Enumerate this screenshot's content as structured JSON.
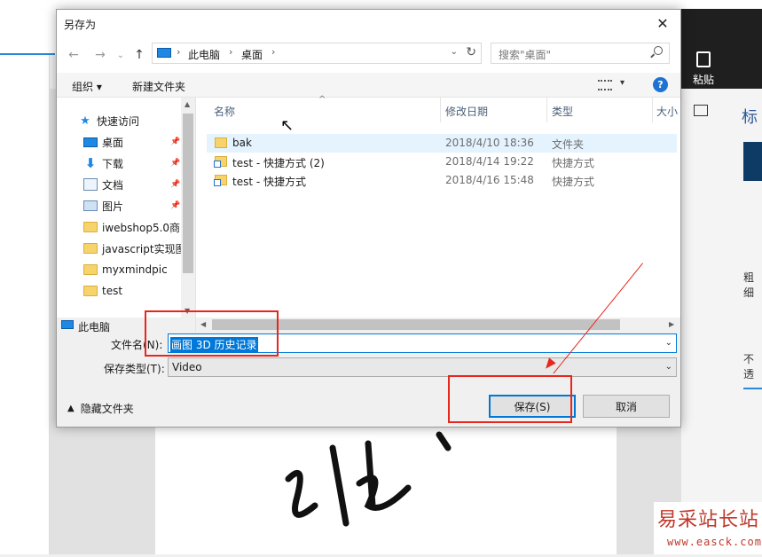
{
  "background": {
    "paste_label": "粘贴",
    "side_title": "标",
    "label_a": "粗细",
    "label_b": "不透"
  },
  "watermark": {
    "main": "易采站长站",
    "sub": "www.easck.com"
  },
  "dialog": {
    "title": "另存为",
    "nav": {
      "breadcrumbs": [
        "此电脑",
        "桌面"
      ],
      "search_placeholder": "搜索\"桌面\""
    },
    "toolbar": {
      "organize": "组织 ▾",
      "new_folder": "新建文件夹"
    },
    "navpane": {
      "items": [
        {
          "label": "快速访问",
          "icon": "star-icon"
        },
        {
          "label": "桌面",
          "icon": "desktop-icon",
          "pinned": true
        },
        {
          "label": "下载",
          "icon": "download-icon",
          "pinned": true
        },
        {
          "label": "文档",
          "icon": "document-icon",
          "pinned": true
        },
        {
          "label": "图片",
          "icon": "picture-icon",
          "pinned": true
        },
        {
          "label": "iwebshop5.0商",
          "icon": "folder-icon"
        },
        {
          "label": "javascript实现图",
          "icon": "folder-icon"
        },
        {
          "label": "myxmindpic",
          "icon": "folder-icon"
        },
        {
          "label": "test",
          "icon": "folder-icon"
        }
      ],
      "this_pc": "此电脑"
    },
    "columns": {
      "name": "名称",
      "date": "修改日期",
      "type": "类型",
      "size": "大小"
    },
    "files": [
      {
        "name": "bak",
        "date": "2018/4/10 18:36",
        "type": "文件夹",
        "kind": "folder",
        "selected": true
      },
      {
        "name": "test - 快捷方式 (2)",
        "date": "2018/4/14 19:22",
        "type": "快捷方式",
        "kind": "shortcut"
      },
      {
        "name": "test - 快捷方式",
        "date": "2018/4/16 15:48",
        "type": "快捷方式",
        "kind": "shortcut"
      }
    ],
    "form": {
      "filename_label": "文件名(N):",
      "filename_value": "画图 3D 历史记录",
      "filetype_label": "保存类型(T):",
      "filetype_value": "Video"
    },
    "footer": {
      "hide_folders": "隐藏文件夹",
      "save": "保存(S)",
      "cancel": "取消"
    }
  },
  "colors": {
    "accent": "#0078d7",
    "annotation": "#e8261c",
    "selection": "#e5f3ff"
  }
}
